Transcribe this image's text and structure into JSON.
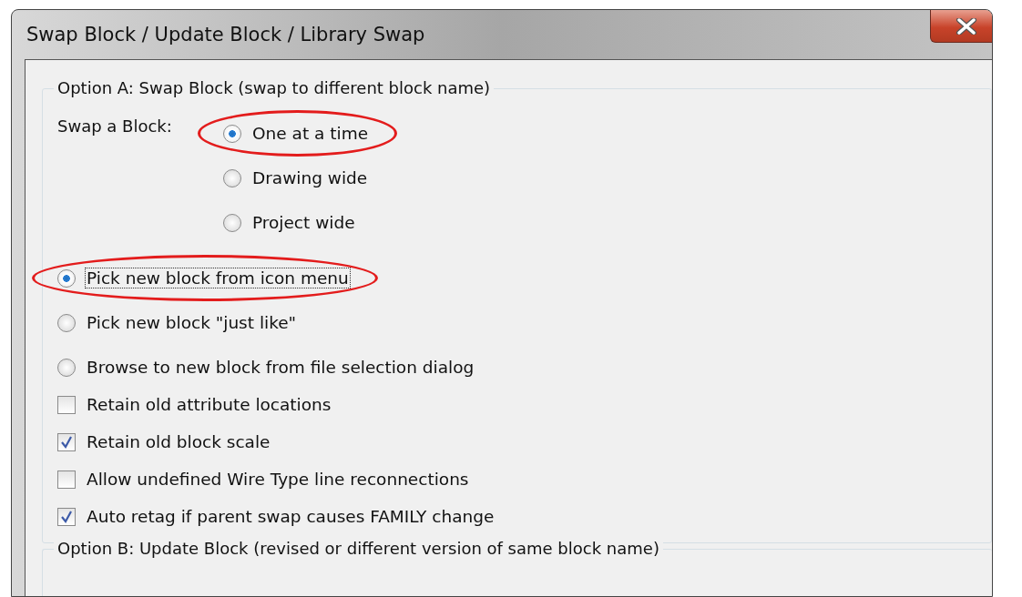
{
  "window": {
    "title": "Swap Block / Update Block / Library Swap"
  },
  "option_a": {
    "legend": "Option A: Swap Block (swap to different block name)",
    "swap_a_block": {
      "label": "Swap a Block:",
      "options": [
        {
          "label": "One at a time",
          "selected": true,
          "circled": true,
          "focused": false
        },
        {
          "label": "Drawing wide",
          "selected": false,
          "circled": false,
          "focused": false
        },
        {
          "label": "Project wide",
          "selected": false,
          "circled": false,
          "focused": false
        }
      ]
    },
    "pick_options": [
      {
        "label": "Pick new block from icon menu",
        "selected": true,
        "circled": true,
        "focused": true
      },
      {
        "label": "Pick new block \"just like\"",
        "selected": false,
        "circled": false,
        "focused": false
      },
      {
        "label": "Browse to new block from file selection dialog",
        "selected": false,
        "circled": false,
        "focused": false
      }
    ],
    "checkboxes": [
      {
        "label": "Retain old attribute locations",
        "checked": false
      },
      {
        "label": "Retain old block scale",
        "checked": true
      },
      {
        "label": "Allow undefined Wire Type line reconnections",
        "checked": false
      },
      {
        "label": "Auto retag if parent swap causes FAMILY change",
        "checked": true
      }
    ]
  },
  "option_b": {
    "legend": "Option B: Update Block (revised or different version of same block name)"
  }
}
